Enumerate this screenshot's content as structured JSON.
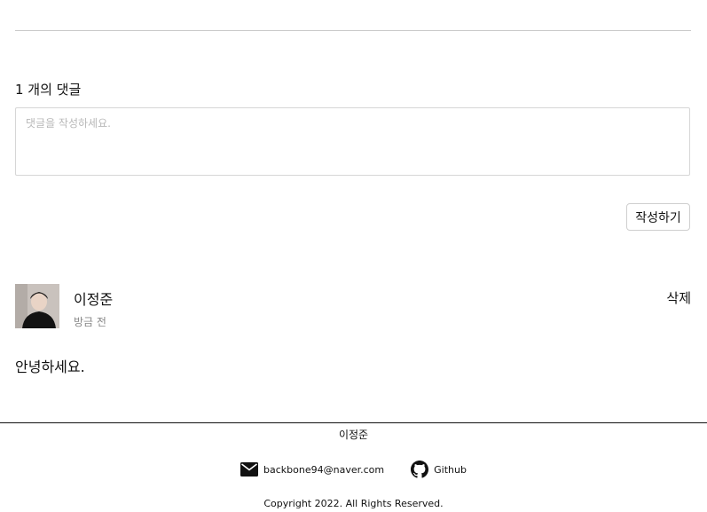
{
  "comments": {
    "count_label": "1 개의 댓글",
    "input": {
      "placeholder": "댓글을 작성하세요.",
      "value": ""
    },
    "submit_label": "작성하기",
    "items": [
      {
        "author": "이정준",
        "time": "방금 전",
        "delete_label": "삭제",
        "body": "안녕하세요."
      }
    ]
  },
  "footer": {
    "name": "이정준",
    "email": "backbone94@naver.com",
    "github_label": "Github",
    "copyright": "Copyright 2022. All Rights Reserved."
  },
  "icons": {
    "email": "mail-icon",
    "github": "github-icon"
  }
}
